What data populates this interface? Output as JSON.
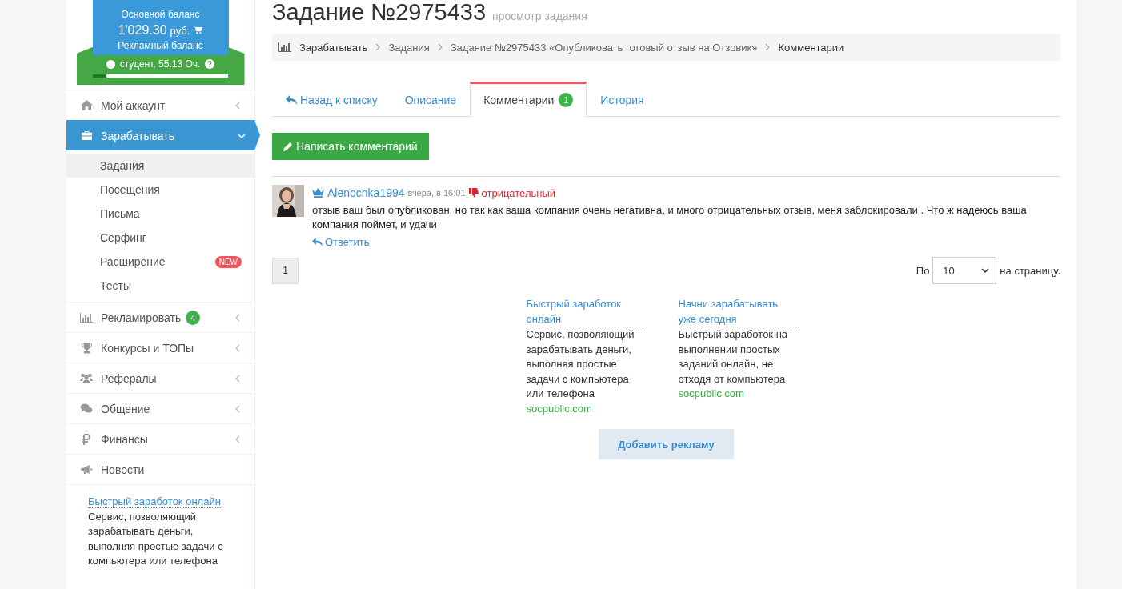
{
  "sidebar": {
    "balance_label": "Основной баланс",
    "balance": "1'029.30",
    "currency": "руб.",
    "ad_balance_label": "Рекламный баланс",
    "status": "студент, 55.13 Оч.",
    "level": 0.1,
    "menu": [
      {
        "label": "Мой аккаунт",
        "kind": "group",
        "selected": false,
        "expanded": false
      },
      {
        "label": "Зарабатывать",
        "kind": "group",
        "selected": true,
        "expanded": true,
        "children": [
          {
            "label": "Задания",
            "selected": true
          },
          {
            "label": "Посещения",
            "selected": false
          },
          {
            "label": "Письма",
            "selected": false
          },
          {
            "label": "Сёрфинг",
            "selected": false
          },
          {
            "label": "Расширение",
            "selected": false,
            "badge": "NEW"
          },
          {
            "label": "Тесты",
            "selected": false
          }
        ]
      },
      {
        "label": "Рекламировать",
        "kind": "group",
        "selected": false,
        "expanded": false,
        "badge": "4"
      },
      {
        "label": "Конкурсы и ТОПы",
        "kind": "group",
        "selected": false,
        "expanded": false
      },
      {
        "label": "Рефералы",
        "kind": "group",
        "selected": false,
        "expanded": false
      },
      {
        "label": "Общение",
        "kind": "group",
        "selected": false,
        "expanded": false
      },
      {
        "label": "Финансы",
        "kind": "group",
        "selected": false,
        "expanded": false
      },
      {
        "label": "Новости",
        "kind": "link",
        "selected": false
      }
    ],
    "ad": {
      "title": "Быстрый заработок онлайн",
      "text": "Сервис, позволяющий зарабатывать деньги, выполняя простые задачи с компьютера или телефона"
    }
  },
  "main": {
    "title": "Задание №2975433",
    "subtitle": "просмотр задания",
    "breadcrumbs": [
      "Зарабатывать",
      "Задания",
      "Задание №2975433 «Опубликовать готовый отзыв на Отзовик»",
      "Комментарии"
    ],
    "tabs": [
      {
        "label": "Назад к списку",
        "kind": "back",
        "selected": false
      },
      {
        "label": "Описание",
        "kind": "tab",
        "selected": false
      },
      {
        "label": "Комментарии",
        "kind": "tab",
        "selected": true,
        "badge": "1"
      },
      {
        "label": "История",
        "kind": "tab",
        "selected": false
      }
    ],
    "write_button": "Написать комментарий",
    "comments": [
      {
        "author": "Alenochka1994",
        "time": "вчера, в 16:01",
        "rating": "отрицательный",
        "negative": true,
        "text": "отзыв ваш был опубликован, но так как ваша компания очень негативна, и много отрицательных отзыв, меня заблокировали . Что ж надеюсь ваша компания поймет, и удачи",
        "reply": "Ответить"
      }
    ],
    "pages": [
      {
        "label": "1",
        "selected": true
      }
    ],
    "per_page": {
      "before": "По",
      "value": "10",
      "after": "на страницу."
    },
    "ads": [
      {
        "title": "Быстрый заработок онлайн",
        "text": "Сервис, позволяющий зарабатывать деньги, выполняя простые задачи с компьютера или телефона",
        "domain": "socpublic.com"
      },
      {
        "title": "Начни зарабатывать уже сегодня",
        "text": "Быстрый заработок на выполнении простых заданий онлайн, не отходя от компьютера",
        "domain": "socpublic.com"
      }
    ],
    "add_ad_button": "Добавить рекламу"
  }
}
